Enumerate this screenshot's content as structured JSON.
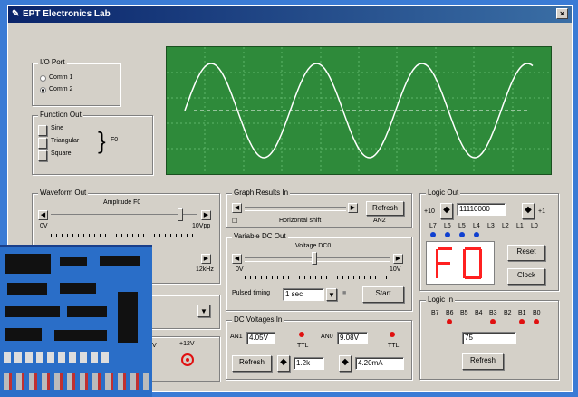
{
  "window": {
    "title": "EPT Electronics Lab",
    "close": "×"
  },
  "io_port": {
    "label": "I/O Port",
    "options": [
      "Comm 1",
      "Comm 2"
    ],
    "selected": "Comm 2"
  },
  "function_out": {
    "label": "Function Out",
    "options": [
      "Sine",
      "Triangular",
      "Square"
    ],
    "output": "F0"
  },
  "waveform_out": {
    "label": "Waveform Out",
    "amplitude_label": "Amplitude F0",
    "amp_min": "0V",
    "amp_max": "10Vpp",
    "freq_max": "12kHz",
    "amplitude_level": 0.9
  },
  "graph_results": {
    "label": "Graph Results In",
    "refresh": "Refresh",
    "horizontal_shift": "Horizontal shift",
    "channel": "AN2"
  },
  "variable_dc": {
    "label": "Variable DC Out",
    "voltage_label": "Voltage DC0",
    "min": "0V",
    "max": "10V",
    "pulsed_timing_label": "Pulsed timing",
    "pulsed_timing_value": "1 sec",
    "start": "Start",
    "level": 0.48
  },
  "dc_voltages": {
    "label": "DC Voltages In",
    "an1_label": "AN1",
    "an1_value": "4.05V",
    "an0_label": "AN0",
    "an0_value": "9.08V",
    "ttl1": "TTL",
    "ttl0": "TTL",
    "refresh": "Refresh",
    "field3": "1.2k",
    "field4": "4.20mA"
  },
  "logic_out": {
    "label": "Logic Out",
    "minus": "+10",
    "value": "11110000",
    "plus": "+1",
    "bit_labels": [
      "L7",
      "L6",
      "L5",
      "L4",
      "L3",
      "L2",
      "L1",
      "L0"
    ],
    "display": "F0",
    "reset": "Reset",
    "clock": "Clock"
  },
  "logic_in": {
    "label": "Logic In",
    "bit_labels": [
      "B7",
      "B6",
      "B5",
      "B4",
      "B3",
      "B2",
      "B1",
      "B0"
    ],
    "value": "75",
    "refresh": "Refresh"
  },
  "supply": {
    "label": "+12V"
  },
  "colors": {
    "scope_bg": "#2e8a3a",
    "trace": "#ffffff",
    "led": "#e01010",
    "bit_on": "#1040d0"
  }
}
